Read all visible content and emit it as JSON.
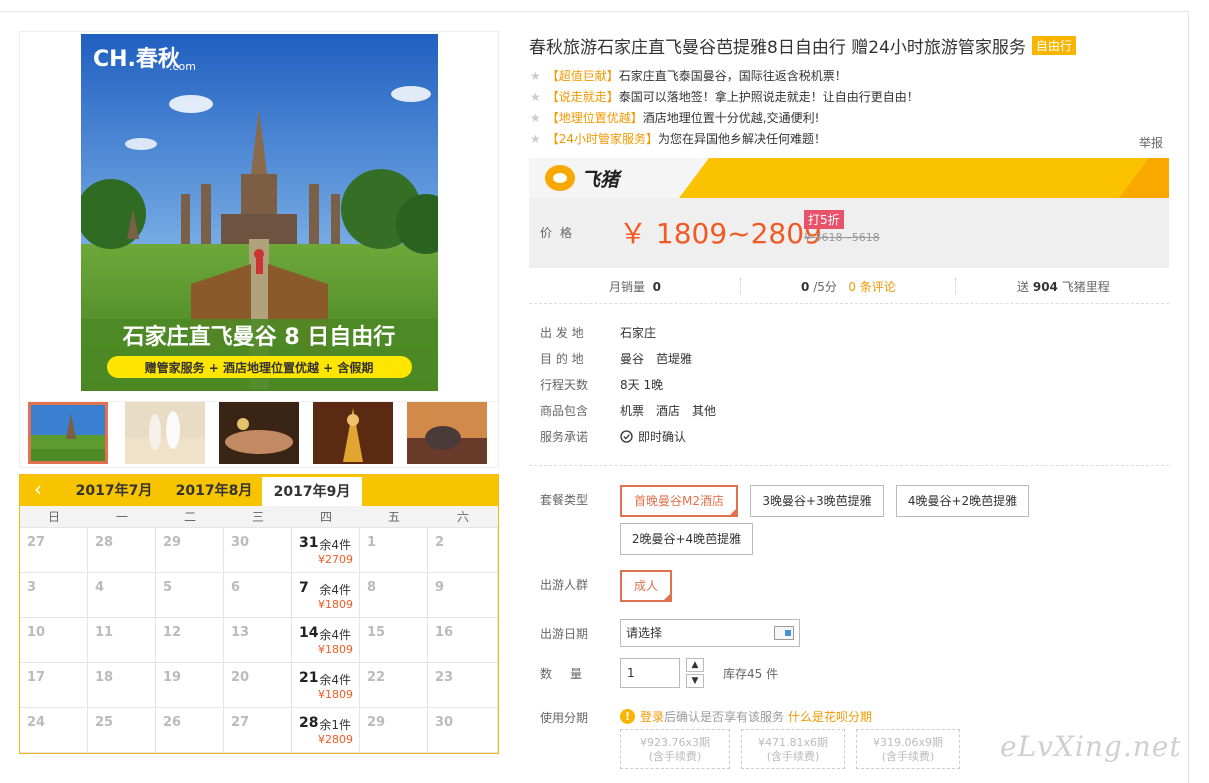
{
  "gallery": {
    "brand": "CH.春秋",
    "brand_sub": ".com",
    "banner_title": "石家庄直飞曼谷 8 日自由行",
    "banner_sub": "赠管家服务 + 酒店地理位置优越 + 含假期",
    "thumbs": [
      "thumb-temple",
      "thumb-beach-couple",
      "thumb-spa-massage",
      "thumb-thai-dancer",
      "thumb-elephant-show"
    ]
  },
  "calendar": {
    "prev_icon": "chevron-left-icon",
    "prev_glyph": "‹",
    "months": [
      "2017年7月",
      "2017年8月",
      "2017年9月"
    ],
    "weekdays": [
      "日",
      "一",
      "二",
      "三",
      "四",
      "五",
      "六"
    ],
    "rows": [
      [
        {
          "d": "27"
        },
        {
          "d": "28"
        },
        {
          "d": "29"
        },
        {
          "d": "30"
        },
        {
          "d": "31",
          "rem": "余4件",
          "price": "¥2709"
        },
        {
          "d": "1"
        },
        {
          "d": "2"
        }
      ],
      [
        {
          "d": "3"
        },
        {
          "d": "4"
        },
        {
          "d": "5"
        },
        {
          "d": "6"
        },
        {
          "d": "7",
          "rem": "余4件",
          "price": "¥1809"
        },
        {
          "d": "8"
        },
        {
          "d": "9"
        }
      ],
      [
        {
          "d": "10"
        },
        {
          "d": "11"
        },
        {
          "d": "12"
        },
        {
          "d": "13"
        },
        {
          "d": "14",
          "rem": "余4件",
          "price": "¥1809"
        },
        {
          "d": "15"
        },
        {
          "d": "16"
        }
      ],
      [
        {
          "d": "17"
        },
        {
          "d": "18"
        },
        {
          "d": "19"
        },
        {
          "d": "20"
        },
        {
          "d": "21",
          "rem": "余4件",
          "price": "¥1809"
        },
        {
          "d": "22"
        },
        {
          "d": "23"
        }
      ],
      [
        {
          "d": "24"
        },
        {
          "d": "25"
        },
        {
          "d": "26"
        },
        {
          "d": "27"
        },
        {
          "d": "28",
          "rem": "余1件",
          "price": "¥2809"
        },
        {
          "d": "29"
        },
        {
          "d": "30"
        }
      ]
    ]
  },
  "product": {
    "title": "春秋旅游石家庄直飞曼谷芭提雅8日自由行 赠24小时旅游管家服务",
    "tag": "自由行",
    "highlights": [
      {
        "tag": "【超值巨献】",
        "text": "石家庄直飞泰国曼谷，国际往返含税机票！"
      },
      {
        "tag": "【说走就走】",
        "text": "泰国可以落地签！拿上护照说走就走！让自由行更自由！"
      },
      {
        "tag": "【地理位置优越】",
        "text": "酒店地理位置十分优越,交通便利!"
      },
      {
        "tag": "【24小时管家服务】",
        "text": "为您在异国他乡解决任何难题！"
      }
    ],
    "star_glyph": "★",
    "report": "举报"
  },
  "fliggy": {
    "logo_text": "飞猪",
    "logo_icon": "fliggy-logo-icon"
  },
  "price": {
    "label": "价格",
    "value": "￥ 1809~2809",
    "discount": "打5折",
    "original": "¥ 3618~5618"
  },
  "stats": {
    "monthly_label": "月销量",
    "monthly_value": "0",
    "rating_value": "0",
    "rating_unit": "/5分",
    "reviews": "0 条评论",
    "miles_prefix": "送",
    "miles_value": "904",
    "miles_suffix": "飞猪里程"
  },
  "info": [
    {
      "label": "出 发 地",
      "values": [
        "石家庄"
      ]
    },
    {
      "label": "目 的 地",
      "values": [
        "曼谷",
        "芭堤雅"
      ]
    },
    {
      "label": "行程天数",
      "values": [
        "8天 1晚"
      ]
    },
    {
      "label": "商品包含",
      "values": [
        "机票",
        "酒店",
        "其他"
      ]
    },
    {
      "label": "服务承诺",
      "values": [
        "即时确认"
      ]
    }
  ],
  "package": {
    "label": "套餐类型",
    "options": [
      "首晚曼谷M2酒店",
      "3晚曼谷+3晚芭提雅",
      "4晚曼谷+2晚芭提雅",
      "2晚曼谷+4晚芭提雅"
    ],
    "selected": 0
  },
  "crowd": {
    "label": "出游人群",
    "options": [
      "成人"
    ],
    "selected": 0
  },
  "date": {
    "label": "出游日期",
    "placeholder": "请选择"
  },
  "quantity": {
    "label": "数量",
    "value": "1",
    "up_glyph": "▲",
    "down_glyph": "▼",
    "stock": "库存45 件"
  },
  "installment": {
    "label": "使用分期",
    "warn_glyph": "!",
    "login_link": "登录",
    "login_text": "后确认是否享有该服务",
    "what_link": "什么是花呗分期",
    "plans": [
      {
        "amount": "¥923.76x3期",
        "fee": "(含手续费)"
      },
      {
        "amount": "¥471.81x6期",
        "fee": "(含手续费)"
      },
      {
        "amount": "¥319.06x9期",
        "fee": "(含手续费)"
      }
    ]
  },
  "watermark": "eLvXing.net"
}
